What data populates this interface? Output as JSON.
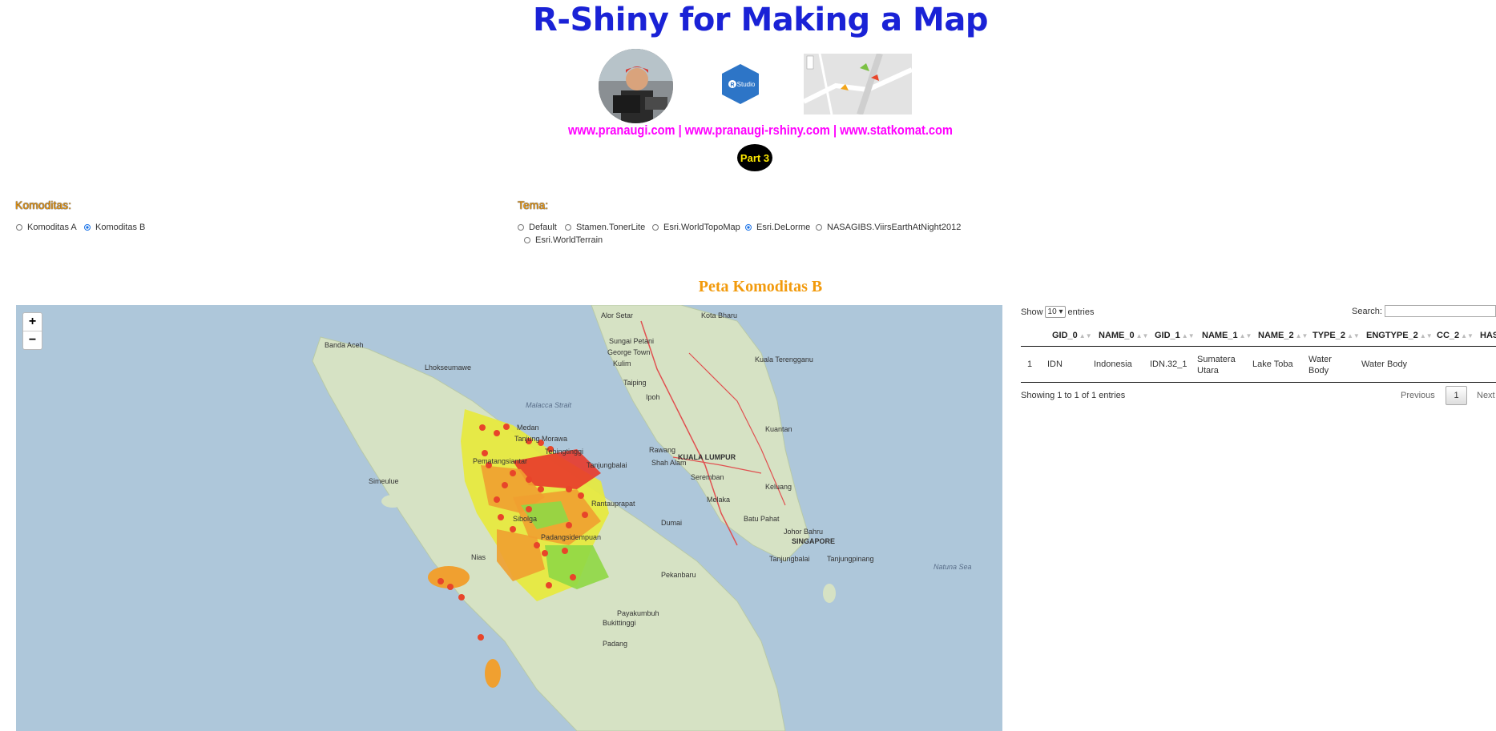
{
  "header": {
    "title": "R-Shiny for Making a Map",
    "links": "www.pranaugi.com | www.pranaugi-rshiny.com | www.statkomat.com",
    "part_badge": "Part 3",
    "rstudio_badge": "R Studio"
  },
  "komoditas": {
    "label": "Komoditas:",
    "options": [
      "Komoditas A",
      "Komoditas B"
    ],
    "selected": "Komoditas B"
  },
  "tema": {
    "label": "Tema:",
    "options": [
      "Default",
      "Stamen.TonerLite",
      "Esri.WorldTopoMap",
      "Esri.DeLorme",
      "NASAGIBS.ViirsEarthAtNight2012",
      "Esri.WorldTerrain"
    ],
    "selected": "Esri.DeLorme"
  },
  "map": {
    "title": "Peta Komoditas B",
    "zoom_in": "+",
    "zoom_out": "−",
    "place_labels": [
      "Banda Aceh",
      "Lhokseumawe",
      "Malacca Strait",
      "Alor Setar",
      "Kota Bharu",
      "Sungai Petani",
      "George Town",
      "Kulim",
      "Taiping",
      "Ipoh",
      "Kuala Terengganu",
      "Tanjung Morawa",
      "Tebingtinggi",
      "Pematangsiantar",
      "Tanjungbalai",
      "Rawang",
      "Shah Alam",
      "KUALA LUMPUR",
      "Seremban",
      "Kuantan",
      "Melaka",
      "Keluang",
      "Batu Pahat",
      "Johor Bahru",
      "SINGAPORE",
      "Tanjungbalai",
      "Tanjungpinang",
      "Natuna Sea",
      "Dumai",
      "Pekanbaru",
      "Payakumbuh",
      "Bukittinggi",
      "Padang",
      "Nias",
      "Simeulue",
      "Rantauprapat",
      "Padangsidempuan",
      "Sibolga",
      "Medan"
    ],
    "colors": {
      "water": "#aec7da",
      "land": "#d9e4c8",
      "red": "#e8392a",
      "orange": "#f0a030",
      "yellow": "#e8ea3a",
      "green": "#8fd845",
      "marker": "#e8452a"
    }
  },
  "table": {
    "show_label": "Show",
    "entries_value": "10",
    "entries_label": "entries",
    "search_label": "Search:",
    "search_value": "",
    "columns": [
      "",
      "GID_0",
      "NAME_0",
      "GID_1",
      "NAME_1",
      "NAME_2",
      "TYPE_2",
      "ENGTYPE_2",
      "CC_2",
      "HAS"
    ],
    "rows": [
      [
        "1",
        "IDN",
        "Indonesia",
        "IDN.32_1",
        "Sumatera Utara",
        "Lake Toba",
        "Water Body",
        "Water Body",
        "",
        ""
      ]
    ],
    "info": "Showing 1 to 1 of 1 entries",
    "prev": "Previous",
    "page": "1",
    "next": "Next"
  }
}
